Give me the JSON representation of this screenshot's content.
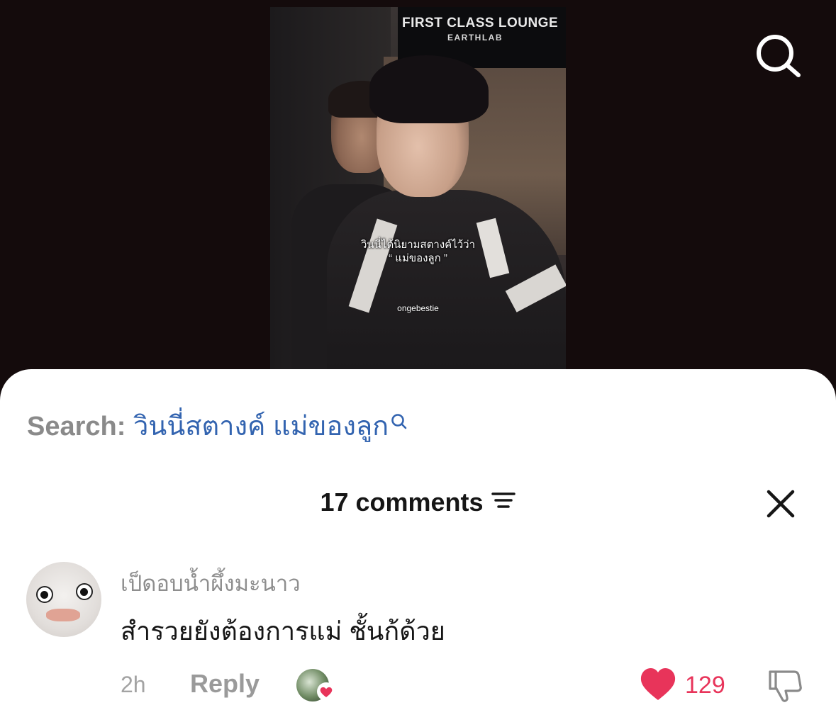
{
  "video": {
    "sign_title": "FIRST CLASS LOUNGE",
    "sign_sub": "EARTHLAB",
    "caption_line1": "วินนี่ได้นิยามสตางค์ไว้ว่า",
    "caption_line2": "“ แม่ของลูก ”",
    "watermark": "ongebestie"
  },
  "search": {
    "prefix": "Search:",
    "query": "วินนี่สตางค์ แม่ของลูก"
  },
  "comments": {
    "header": "17 comments"
  },
  "comment": {
    "username": "เป็ดอบน้ำผึ้งมะนาว",
    "text": "สำรวยยังต้องการแม่ ชั้นก้ด้วย",
    "time": "2h",
    "reply_label": "Reply",
    "likes": "129"
  },
  "icons": {
    "top_search": "search-icon",
    "mini_search": "search-icon",
    "sort": "sort-icon",
    "close": "close-icon",
    "like": "heart-icon",
    "dislike": "thumbs-down-icon",
    "creator_liked": "heart-icon"
  },
  "colors": {
    "accent_red": "#e8345a",
    "search_link": "#3364b0"
  }
}
